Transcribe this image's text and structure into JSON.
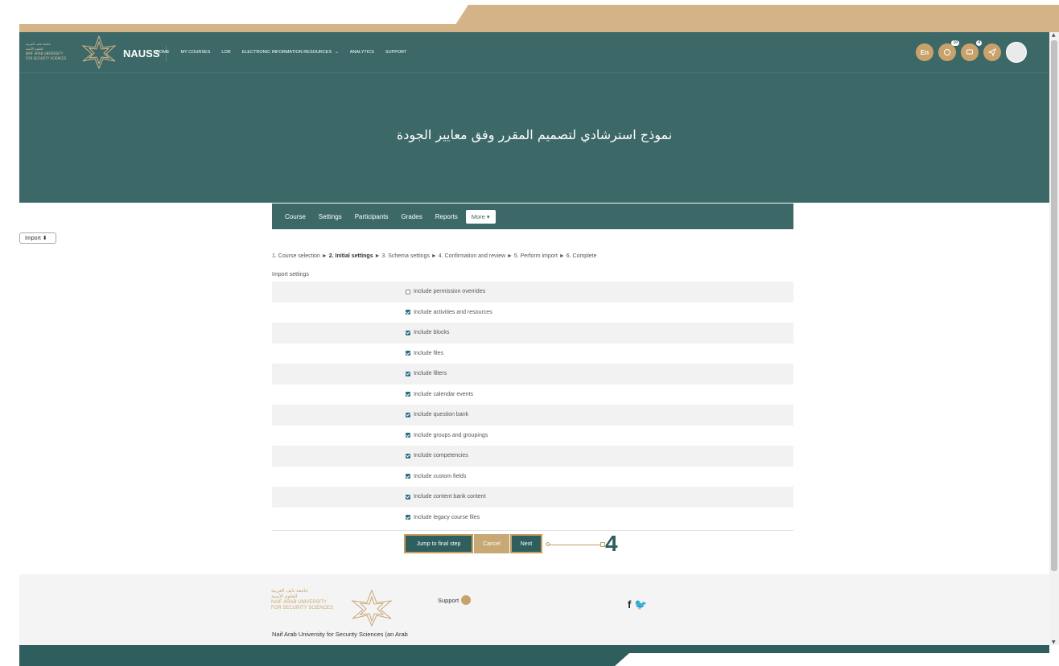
{
  "navbar": {
    "logo_lines": [
      "جامعة نايف العربية",
      "للعلوم الأمنية",
      "NAIF ARAB UNIVERSITY",
      "FOR SECURITY SCIENCES"
    ],
    "brand": "NAUSS",
    "links": [
      "HOME",
      "MY COURSES",
      "LOR",
      "ELECTRONIC INFORMATION RESOURCES",
      "ANALYTICS",
      "SUPPORT"
    ],
    "lang": "En",
    "badge_notifications": "10",
    "badge_messages": "4"
  },
  "page_title": "نموذج استرشادي لتصميم المقرر وفق معايير الجودة",
  "course_nav": {
    "items": [
      "Course",
      "Settings",
      "Participants",
      "Grades",
      "Reports"
    ],
    "more": "More ▾"
  },
  "import_select": "Import ⬍",
  "steps": {
    "s1": "1. Course selection ► ",
    "s2": "2. Initial settings",
    "rest": " ► 3. Schema settings ► 4. Confirmation and review ► 5. Perform import ► 6. Complete"
  },
  "section_title": "Import settings",
  "settings": [
    {
      "label": "Include permission overrides",
      "checked": false
    },
    {
      "label": "Include activities and resources",
      "checked": true
    },
    {
      "label": "Include blocks",
      "checked": true
    },
    {
      "label": "Include files",
      "checked": true
    },
    {
      "label": "Include filters",
      "checked": true
    },
    {
      "label": "Include calendar events",
      "checked": true
    },
    {
      "label": "Include question bank",
      "checked": true
    },
    {
      "label": "Include groups and groupings",
      "checked": true
    },
    {
      "label": "Include competencies",
      "checked": true
    },
    {
      "label": "Include custom fields",
      "checked": true
    },
    {
      "label": "Include content bank content",
      "checked": true
    },
    {
      "label": "Include legacy course files",
      "checked": true
    }
  ],
  "buttons": {
    "jump": "Jump to final step",
    "cancel": "Cancel",
    "next": "Next"
  },
  "callout_number": "4",
  "footer": {
    "logo_lines": [
      "جامعة نايف العربية",
      "للعلوم الأمنية",
      "NAIF ARAB UNIVERSITY",
      "FOR SECURITY SCIENCES"
    ],
    "name": "Naif Arab University for Security Sciences (an Arab",
    "support": "Support",
    "social": "f 🐦"
  },
  "colors": {
    "header_bg": "#3d6868",
    "accent": "#c8a26a",
    "button_dark": "#2f5e5e"
  }
}
